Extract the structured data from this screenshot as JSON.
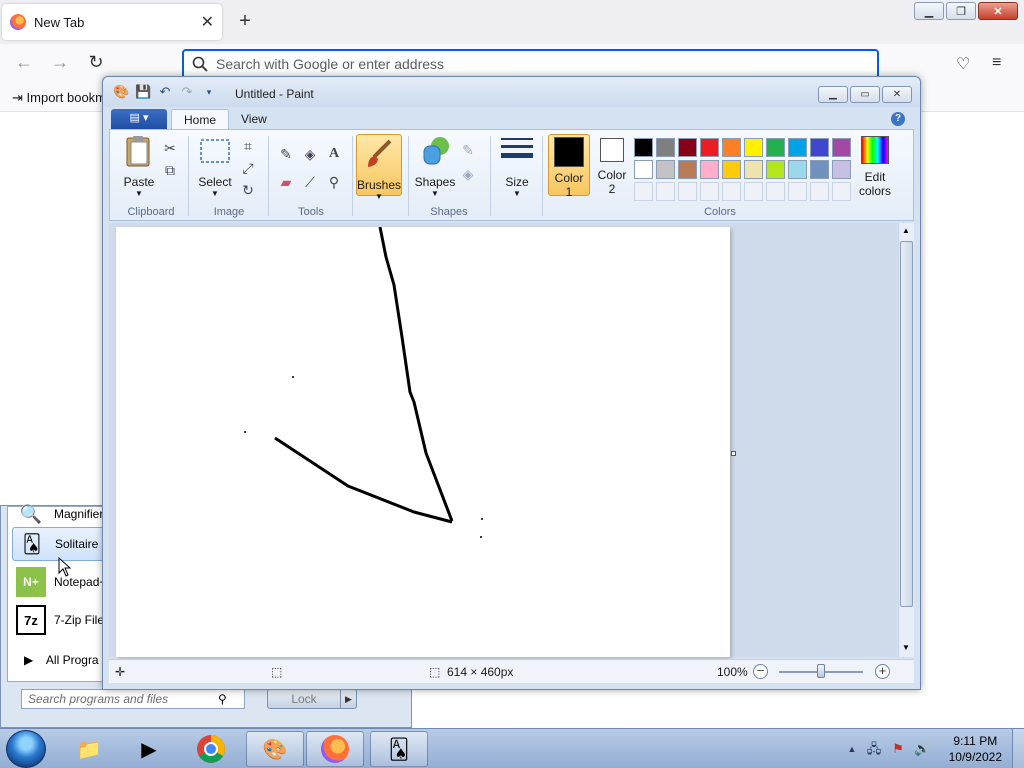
{
  "browser": {
    "tab_title": "New Tab",
    "tab_close": "✕",
    "new_tab": "+",
    "address_placeholder": "Search with Google or enter address",
    "bookmark_import": "Import bookm"
  },
  "start_menu": {
    "items": [
      {
        "label": "Magnifier"
      },
      {
        "label": "Solitaire"
      },
      {
        "label": "Notepad+"
      },
      {
        "label": "7-Zip File"
      }
    ],
    "all_programs": "All Progra",
    "search_placeholder": "Search programs and files",
    "lock_label": "Lock"
  },
  "paint": {
    "title": "Untitled - Paint",
    "tabs": [
      "Home",
      "View"
    ],
    "groups": {
      "clipboard": "Clipboard",
      "image": "Image",
      "tools": "Tools",
      "shapes": "Shapes",
      "colors": "Colors"
    },
    "buttons": {
      "paste": "Paste",
      "select": "Select",
      "brushes": "Brushes",
      "shapes": "Shapes",
      "size": "Size",
      "color1_line1": "Color",
      "color1_line2": "1",
      "color2_line1": "Color",
      "color2_line2": "2",
      "edit_colors_line1": "Edit",
      "edit_colors_line2": "colors"
    },
    "palette_row1": [
      "#000000",
      "#7f7f7f",
      "#880015",
      "#ed1c24",
      "#ff7f27",
      "#fff200",
      "#22b14c",
      "#00a2e8",
      "#3f48cc",
      "#a349a4"
    ],
    "palette_row2": [
      "#ffffff",
      "#c3c3c3",
      "#b97a57",
      "#ffaec9",
      "#ffc90e",
      "#efe4b0",
      "#b5e61d",
      "#99d9ea",
      "#7092be",
      "#c8bfe7"
    ],
    "color1": "#000000",
    "color2": "#ffffff",
    "status": {
      "canvas_size": "614 × 460px",
      "zoom": "100%"
    }
  },
  "taskbar": {
    "time": "9:11 PM",
    "date": "10/9/2022"
  }
}
